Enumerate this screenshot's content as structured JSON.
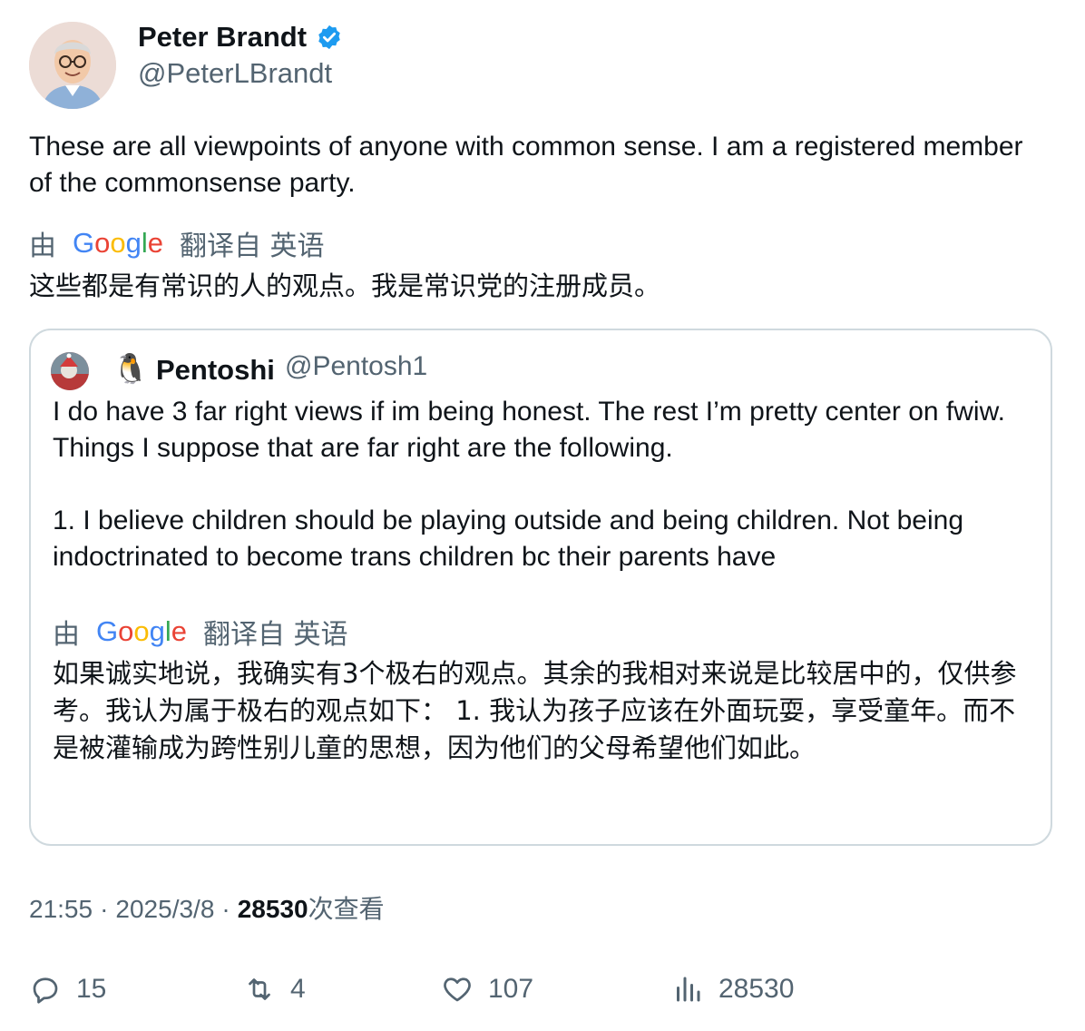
{
  "author": {
    "name": "Peter Brandt",
    "handle": "@PeterLBrandt",
    "verified": true
  },
  "tweet": {
    "text": "These are all viewpoints of anyone with common sense. I am a registered member of the commonsense party.",
    "translation": {
      "prefix": "由",
      "provider": "Google",
      "suffix": "翻译自 英语",
      "text": "这些都是有常识的人的观点。我是常识党的注册成员。"
    }
  },
  "quote": {
    "emoji": "🐧",
    "name": "Pentoshi",
    "handle": "@Pentosh1",
    "paragraphs": [
      "I do have 3 far right views if im being honest. The rest I’m pretty center on fwiw. Things I suppose that are far right are the following.",
      "1. I believe children should be playing outside and being children. Not being indoctrinated to become trans children bc their parents have"
    ],
    "translation": {
      "prefix": "由",
      "provider": "Google",
      "suffix": "翻译自 英语",
      "text": "如果诚实地说，我确实有3个极右的观点。其余的我相对来说是比较居中的，仅供参考。我认为属于极右的观点如下： 1. 我认为孩子应该在外面玩耍，享受童年。而不是被灌输成为跨性别儿童的思想，因为他们的父母希望他们如此。"
    }
  },
  "meta": {
    "time": "21:55",
    "date": "2025/3/8",
    "views_count": "28530",
    "views_label": "次查看"
  },
  "actions": {
    "replies": "15",
    "retweets": "4",
    "likes": "107",
    "views": "28530"
  },
  "colors": {
    "text": "#0f1419",
    "muted": "#536471",
    "border": "#cfd9de",
    "verified": "#1d9bf0"
  }
}
